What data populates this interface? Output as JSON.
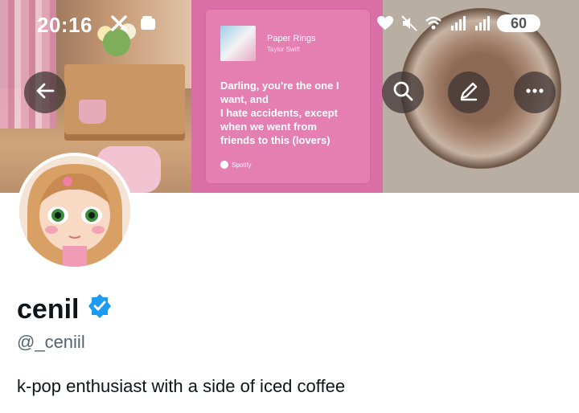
{
  "status_bar": {
    "time": "20:16",
    "battery": "60",
    "left_icons": [
      "x-logo-icon",
      "wallet-icon"
    ],
    "right_icons": [
      "heart-icon",
      "mute-icon",
      "wifi-icon",
      "signal-icon",
      "signal-icon"
    ]
  },
  "banner": {
    "song_title": "Paper Rings",
    "song_artist": "Taylor Swift",
    "lyrics": [
      "Darling, you're the one I",
      "want, and",
      "I hate accidents, except",
      "when we went from",
      "friends to this (lovers)"
    ],
    "source": "Spotify",
    "colors": {
      "mid_panel": "#da6ea6",
      "card": "#e57fb2"
    }
  },
  "header_buttons": {
    "back": "back-arrow-icon",
    "search": "search-icon",
    "edit": "edit-icon",
    "more": "more-icon"
  },
  "profile": {
    "display_name": "cenil",
    "handle": "@_ceniil",
    "bio": "k-pop enthusiast with a side of iced coffee",
    "verified_color": "#1d9bf0"
  }
}
